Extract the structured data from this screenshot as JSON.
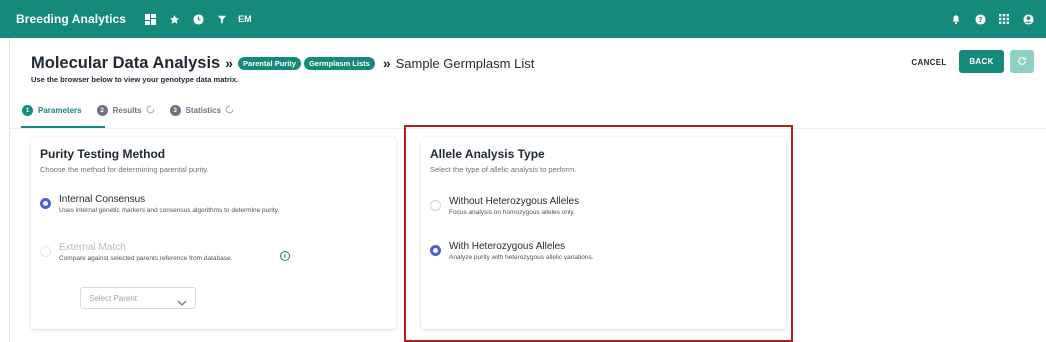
{
  "topbar": {
    "brand": "Breeding Analytics",
    "user_initials": "EM",
    "left_icons": [
      "dashboard-icon",
      "star-icon",
      "clock-icon",
      "filter-icon"
    ],
    "right_icons": [
      "bell-icon",
      "help-icon",
      "apps-grid-icon",
      "account-icon"
    ],
    "color": "#15897a"
  },
  "header": {
    "title": "Molecular Data Analysis",
    "separator": "»",
    "pills": [
      "Parental Purity",
      "Germplasm Lists"
    ],
    "crumb_last": "Sample Germplasm List",
    "subtitle": "Use the browser below to view your genotype data matrix.",
    "cancel_label": "CANCEL",
    "back_label": "BACK"
  },
  "tabs": [
    {
      "num": "1",
      "label": "Parameters",
      "active": true
    },
    {
      "num": "2",
      "label": "Results",
      "active": false
    },
    {
      "num": "3",
      "label": "Statistics",
      "active": false
    }
  ],
  "purity_card": {
    "title": "Purity Testing Method",
    "description": "Choose the method for determining parental purity.",
    "options": [
      {
        "label": "Internal Consensus",
        "description": "Uses internal genetic markers and consensus algorithms to determine purity.",
        "checked": true,
        "disabled": false
      },
      {
        "label": "External Match",
        "description": "Compare against selected parents reference from database.",
        "checked": false,
        "disabled": true
      }
    ],
    "select_placeholder": "Select Parent",
    "info_glyph": "i"
  },
  "allele_card": {
    "title": "Allele Analysis Type",
    "description": "Select the type of allelic analysis to perform.",
    "options": [
      {
        "label": "Without Heterozygous Alleles",
        "description": "Focus analysis on homozygous alleles only.",
        "checked": false
      },
      {
        "label": "With Heterozygous Alleles",
        "description": "Analyze purity with heterozygous allelic variations.",
        "checked": true
      }
    ]
  },
  "colors": {
    "primary": "#15897a",
    "radio_selected": "#4f5fd8",
    "highlight_box": "#b01e1e"
  }
}
